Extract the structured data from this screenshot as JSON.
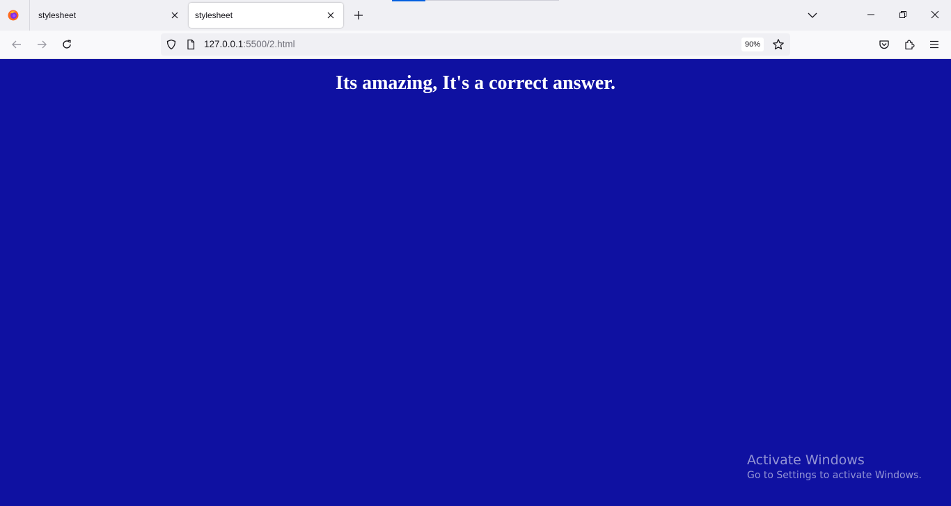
{
  "tabs": [
    {
      "title": "stylesheet",
      "active": false
    },
    {
      "title": "stylesheet",
      "active": true
    }
  ],
  "urlbar": {
    "host": "127.0.0.1",
    "path": ":5500/2.html",
    "zoom": "90%"
  },
  "page": {
    "heading": "Its amazing, It's a correct answer.",
    "background_color": "#0f11a1"
  },
  "watermark": {
    "title": "Activate Windows",
    "subtitle": "Go to Settings to activate Windows."
  },
  "icons": {
    "browser": "firefox-logo",
    "tab_close": "close-icon",
    "new_tab": "plus-icon",
    "list_tabs": "chevron-down-icon",
    "minimize": "minimize-icon",
    "restore": "restore-icon",
    "close_window": "close-icon",
    "back": "arrow-left-icon",
    "forward": "arrow-right-icon",
    "reload": "reload-icon",
    "tracking_protection": "shield-icon",
    "page_info": "document-icon",
    "bookmark": "star-icon",
    "pocket": "pocket-icon",
    "extensions": "puzzle-icon",
    "menu": "hamburger-icon"
  }
}
